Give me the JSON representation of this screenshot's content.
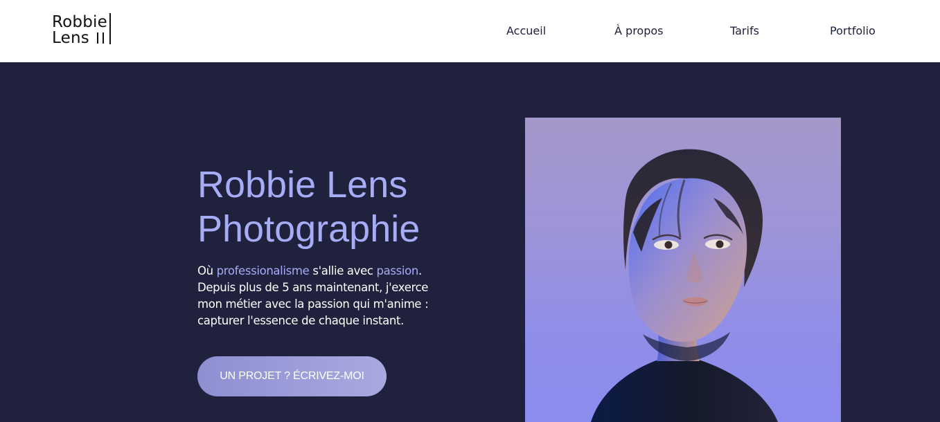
{
  "brand": {
    "line1": "Robbie",
    "line2": "Lens"
  },
  "nav": {
    "items": [
      {
        "label": "Accueil"
      },
      {
        "label": "À propos"
      },
      {
        "label": "Tarifs"
      },
      {
        "label": "Portfolio"
      }
    ]
  },
  "hero": {
    "title_line1": "Robbie Lens",
    "title_line2": "Photographie",
    "intro_prefix": "Où ",
    "intro_highlight1": "professionalisme",
    "intro_middle": " s'allie avec ",
    "intro_highlight2": "passion",
    "intro_suffix": ".",
    "body": "Depuis plus de 5 ans maintenant, j'exerce mon métier avec la passion qui m'anime : capturer l'essence de chaque instant.",
    "cta_label": "UN PROJET ? ÉCRIVEZ-MOI"
  },
  "colors": {
    "accent": "#a6acf6",
    "background": "#20213d",
    "header_bg": "#ffffff",
    "button": "#9d9ddb"
  },
  "icons": {
    "portrait_image": "portrait-photo"
  }
}
